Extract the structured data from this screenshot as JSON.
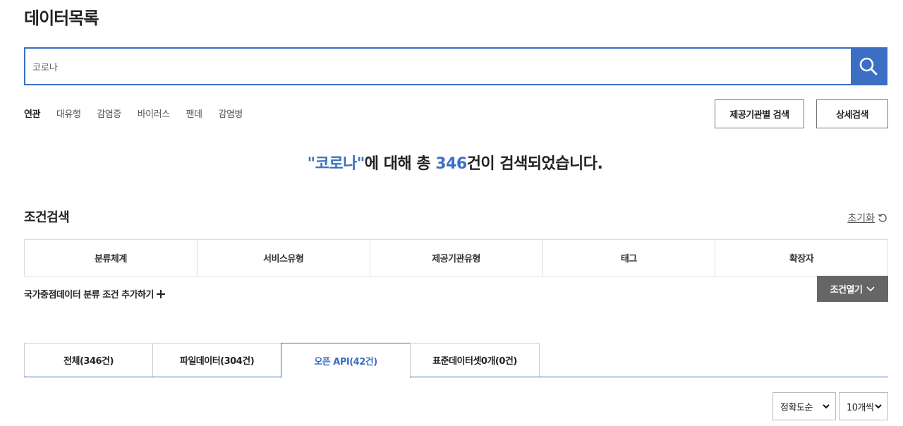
{
  "page": {
    "title": "데이터목록"
  },
  "search": {
    "value": "코로나",
    "button_icon": "search-icon"
  },
  "related": {
    "label": "연관",
    "keywords": [
      "대유행",
      "감염증",
      "바이러스",
      "팬데",
      "감염병"
    ]
  },
  "buttons": {
    "provider_search": "제공기관별 검색",
    "detail_search": "상세검색"
  },
  "result": {
    "quote_open": "\"",
    "keyword": "코로나",
    "quote_close": "\"",
    "middle": "에 대해 총 ",
    "count": "346",
    "suffix": "건이 검색되었습니다."
  },
  "conditions": {
    "title": "조건검색",
    "reset_label": "초기화",
    "columns": [
      "분류체계",
      "서비스유형",
      "제공기관유형",
      "태그",
      "확장자"
    ],
    "add_label": "국가중점데이터 분류 조건 추가하기",
    "open_label": "조건열기"
  },
  "tabs": [
    {
      "label": "전체(346건)",
      "active": false
    },
    {
      "label": "파일데이터(304건)",
      "active": false
    },
    {
      "label": "오픈 API(42건)",
      "active": true
    },
    {
      "label": "표준데이터셋0개(0건)",
      "active": false
    }
  ],
  "sort": {
    "selected": "정확도순"
  },
  "page_size": {
    "selected": "10개씩"
  },
  "colors": {
    "accent": "#3a6fc4",
    "dark_button": "#666666"
  }
}
